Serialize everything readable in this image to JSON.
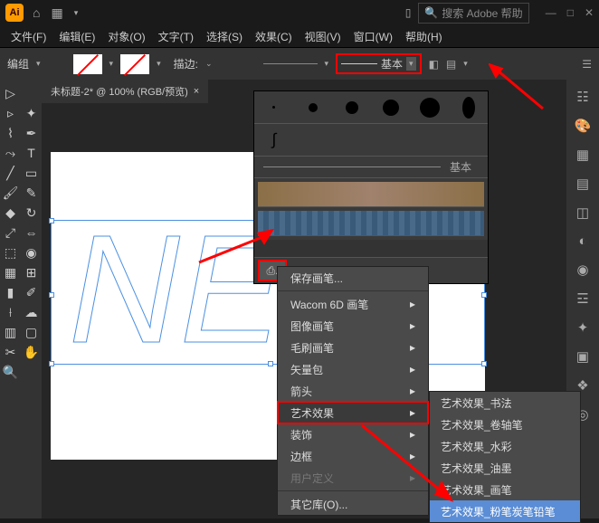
{
  "titlebar": {
    "logo": "Ai",
    "search_placeholder": "搜索 Adobe 帮助"
  },
  "menu": {
    "file": "文件(F)",
    "edit": "编辑(E)",
    "object": "对象(O)",
    "type": "文字(T)",
    "select": "选择(S)",
    "effect": "效果(C)",
    "view": "视图(V)",
    "window": "窗口(W)",
    "help": "帮助(H)"
  },
  "optbar": {
    "mode": "编组",
    "stroke_label": "描边:",
    "basic": "基本"
  },
  "tab": {
    "title": "未标题-2* @ 100% (RGB/预览)",
    "close": "×"
  },
  "brush_panel": {
    "basic": "基本"
  },
  "ctx": {
    "save": "保存画笔...",
    "wacom": "Wacom 6D 画笔",
    "image": "图像画笔",
    "bristle": "毛刷画笔",
    "vector": "矢量包",
    "arrow": "箭头",
    "art": "艺术效果",
    "deco": "装饰",
    "border": "边框",
    "user": "用户定义",
    "other": "其它库(O)..."
  },
  "sub": {
    "calli": "艺术效果_书法",
    "scroll": "艺术效果_卷轴笔",
    "water": "艺术效果_水彩",
    "ink": "艺术效果_油墨",
    "paint": "艺术效果_画笔",
    "chalk": "艺术效果_粉笔炭笔铅笔"
  },
  "canvas_text": "NEW"
}
